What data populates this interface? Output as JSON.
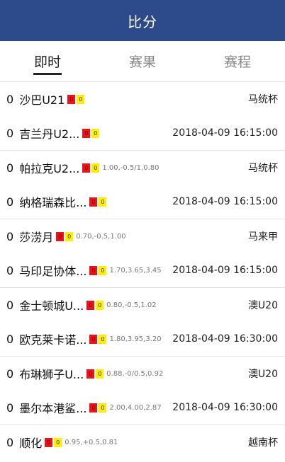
{
  "header": {
    "title": "比分"
  },
  "tabs": [
    {
      "label": "即时",
      "active": true
    },
    {
      "label": "赛果",
      "active": false
    },
    {
      "label": "赛程",
      "active": false
    }
  ],
  "matches": [
    {
      "league": "马统杯",
      "home": {
        "score": "0",
        "team": "沙巴U21",
        "red": "0",
        "yellow": "0",
        "odds": ""
      },
      "away": {
        "score": "0",
        "team": "吉兰丹U2...",
        "red": "0",
        "yellow": "0",
        "odds": ""
      },
      "time": "2018-04-09 16:15:00"
    },
    {
      "league": "马统杯",
      "home": {
        "score": "0",
        "team": "帕拉克U2...",
        "red": "0",
        "yellow": "0",
        "odds": "1.00,-0.5/1,0.80"
      },
      "away": {
        "score": "0",
        "team": "纳格瑞森比...",
        "red": "0",
        "yellow": "0",
        "odds": ""
      },
      "time": "2018-04-09 16:15:00"
    },
    {
      "league": "马来甲",
      "home": {
        "score": "0",
        "team": "莎涝月",
        "red": "0",
        "yellow": "0",
        "odds": "0.70,-0.5,1.00"
      },
      "away": {
        "score": "0",
        "team": "马印足协体...",
        "red": "0",
        "yellow": "0",
        "odds": "1.70,3.65,3.45"
      },
      "time": "2018-04-09 16:15:00"
    },
    {
      "league": "澳U20",
      "home": {
        "score": "0",
        "team": "金士顿城U...",
        "red": "0",
        "yellow": "0",
        "odds": "0.80,-0.5,1.02"
      },
      "away": {
        "score": "0",
        "team": "欧克莱卡诺...",
        "red": "0",
        "yellow": "0",
        "odds": "1.80,3.95,3.20"
      },
      "time": "2018-04-09 16:30:00"
    },
    {
      "league": "澳U20",
      "home": {
        "score": "0",
        "team": "布琳狮子U...",
        "red": "0",
        "yellow": "0",
        "odds": "0.88,-0/0.5,0.92"
      },
      "away": {
        "score": "0",
        "team": "墨尔本港鲨...",
        "red": "0",
        "yellow": "0",
        "odds": "2.00,4.00,2.87"
      },
      "time": "2018-04-09 16:30:00"
    },
    {
      "league": "越南杯",
      "home": {
        "score": "0",
        "team": "顺化",
        "red": "0",
        "yellow": "0",
        "odds": "0.95,+0.5,0.81"
      },
      "away": null,
      "time": ""
    }
  ]
}
